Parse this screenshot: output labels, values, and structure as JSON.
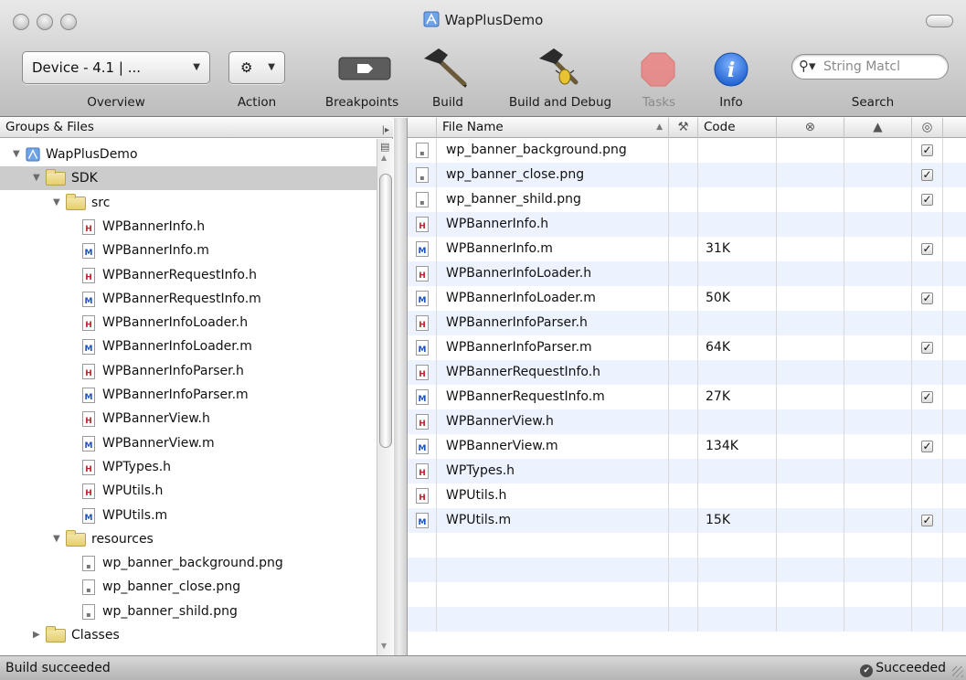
{
  "window": {
    "title": "WapPlusDemo"
  },
  "toolbar": {
    "overview_popup": "Device - 4.1 | ...",
    "overview_label": "Overview",
    "action_label": "Action",
    "breakpoints_label": "Breakpoints",
    "build_label": "Build",
    "build_debug_label": "Build and Debug",
    "tasks_label": "Tasks",
    "info_label": "Info",
    "search_label": "Search",
    "search_placeholder": "String Matcl",
    "info_glyph": "i"
  },
  "sidebar": {
    "header": "Groups & Files",
    "tree": [
      {
        "label": "WapPlusDemo",
        "kind": "project",
        "depth": 0,
        "expanded": true
      },
      {
        "label": "SDK",
        "kind": "folder",
        "depth": 1,
        "expanded": true,
        "selected": true
      },
      {
        "label": "src",
        "kind": "folder",
        "depth": 2,
        "expanded": true
      },
      {
        "label": "WPBannerInfo.h",
        "kind": "h",
        "depth": 3
      },
      {
        "label": "WPBannerInfo.m",
        "kind": "m",
        "depth": 3
      },
      {
        "label": "WPBannerRequestInfo.h",
        "kind": "h",
        "depth": 3
      },
      {
        "label": "WPBannerRequestInfo.m",
        "kind": "m",
        "depth": 3
      },
      {
        "label": "WPBannerInfoLoader.h",
        "kind": "h",
        "depth": 3
      },
      {
        "label": "WPBannerInfoLoader.m",
        "kind": "m",
        "depth": 3
      },
      {
        "label": "WPBannerInfoParser.h",
        "kind": "h",
        "depth": 3
      },
      {
        "label": "WPBannerInfoParser.m",
        "kind": "m",
        "depth": 3
      },
      {
        "label": "WPBannerView.h",
        "kind": "h",
        "depth": 3
      },
      {
        "label": "WPBannerView.m",
        "kind": "m",
        "depth": 3
      },
      {
        "label": "WPTypes.h",
        "kind": "h",
        "depth": 3
      },
      {
        "label": "WPUtils.h",
        "kind": "h",
        "depth": 3
      },
      {
        "label": "WPUtils.m",
        "kind": "m",
        "depth": 3
      },
      {
        "label": "resources",
        "kind": "folder",
        "depth": 2,
        "expanded": true
      },
      {
        "label": "wp_banner_background.png",
        "kind": "png",
        "depth": 3
      },
      {
        "label": "wp_banner_close.png",
        "kind": "png",
        "depth": 3
      },
      {
        "label": "wp_banner_shild.png",
        "kind": "png",
        "depth": 3
      },
      {
        "label": "Classes",
        "kind": "folder",
        "depth": 1,
        "expanded": false
      }
    ]
  },
  "filelist": {
    "columns": {
      "name": "File Name",
      "code": "Code"
    },
    "rows": [
      {
        "name": "wp_banner_background.png",
        "kind": "png",
        "code": "",
        "checked": true
      },
      {
        "name": "wp_banner_close.png",
        "kind": "png",
        "code": "",
        "checked": true
      },
      {
        "name": "wp_banner_shild.png",
        "kind": "png",
        "code": "",
        "checked": true
      },
      {
        "name": "WPBannerInfo.h",
        "kind": "h",
        "code": "",
        "checked": false
      },
      {
        "name": "WPBannerInfo.m",
        "kind": "m",
        "code": "31K",
        "checked": true
      },
      {
        "name": "WPBannerInfoLoader.h",
        "kind": "h",
        "code": "",
        "checked": false
      },
      {
        "name": "WPBannerInfoLoader.m",
        "kind": "m",
        "code": "50K",
        "checked": true
      },
      {
        "name": "WPBannerInfoParser.h",
        "kind": "h",
        "code": "",
        "checked": false
      },
      {
        "name": "WPBannerInfoParser.m",
        "kind": "m",
        "code": "64K",
        "checked": true
      },
      {
        "name": "WPBannerRequestInfo.h",
        "kind": "h",
        "code": "",
        "checked": false
      },
      {
        "name": "WPBannerRequestInfo.m",
        "kind": "m",
        "code": "27K",
        "checked": true
      },
      {
        "name": "WPBannerView.h",
        "kind": "h",
        "code": "",
        "checked": false
      },
      {
        "name": "WPBannerView.m",
        "kind": "m",
        "code": "134K",
        "checked": true
      },
      {
        "name": "WPTypes.h",
        "kind": "h",
        "code": "",
        "checked": false
      },
      {
        "name": "WPUtils.h",
        "kind": "h",
        "code": "",
        "checked": false
      },
      {
        "name": "WPUtils.m",
        "kind": "m",
        "code": "15K",
        "checked": true
      }
    ]
  },
  "status": {
    "left": "Build succeeded",
    "right": "Succeeded"
  },
  "colors": {
    "info_blue": "#1e6fe0",
    "tasks_red": "#e06060",
    "row_alt": "#edf3fe",
    "selection": "#cccccc"
  }
}
